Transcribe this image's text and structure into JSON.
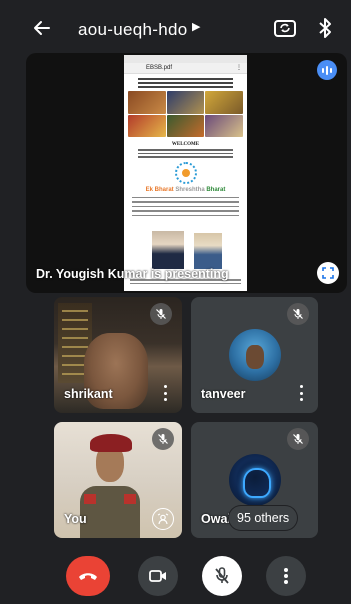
{
  "header": {
    "meeting_code": "aou-ueqh-hdo",
    "icons": {
      "back": "arrow-left-icon",
      "chevron": "chevron-right-icon",
      "switch_camera": "switch-camera-icon",
      "bluetooth": "bluetooth-icon"
    }
  },
  "presentation": {
    "presenter_label": "Dr. Yougish Kumar is presenting",
    "document": {
      "app_bar_title": "EBSB.pdf",
      "welcome_text": "WELCOME",
      "banner_words": [
        "Ek Bharat",
        "Shreshtha",
        "Bharat"
      ]
    },
    "icons": {
      "audio": "audio-level-icon",
      "expand": "fullscreen-icon"
    }
  },
  "participants": [
    {
      "name": "shrikant",
      "muted": true,
      "has_video": true,
      "icons": [
        "mic-off-icon",
        "more-vert-icon"
      ]
    },
    {
      "name": "tanveer",
      "muted": true,
      "has_video": false,
      "icons": [
        "mic-off-icon",
        "more-vert-icon"
      ]
    },
    {
      "name": "You",
      "muted": true,
      "has_video": true,
      "icons": [
        "mic-off-icon",
        "background-effects-icon"
      ]
    },
    {
      "name": "Owai",
      "muted": true,
      "has_video": false,
      "icons": [
        "mic-off-icon"
      ]
    }
  ],
  "others_label": "95 others",
  "controls": {
    "icons": {
      "end_call": "end-call-icon",
      "camera": "camera-icon",
      "mic": "mic-off-icon",
      "more": "more-vert-icon"
    }
  },
  "colors": {
    "background": "#202124",
    "tile": "#3c4043",
    "end_call": "#ea4335",
    "accent": "#4a8ef5"
  }
}
